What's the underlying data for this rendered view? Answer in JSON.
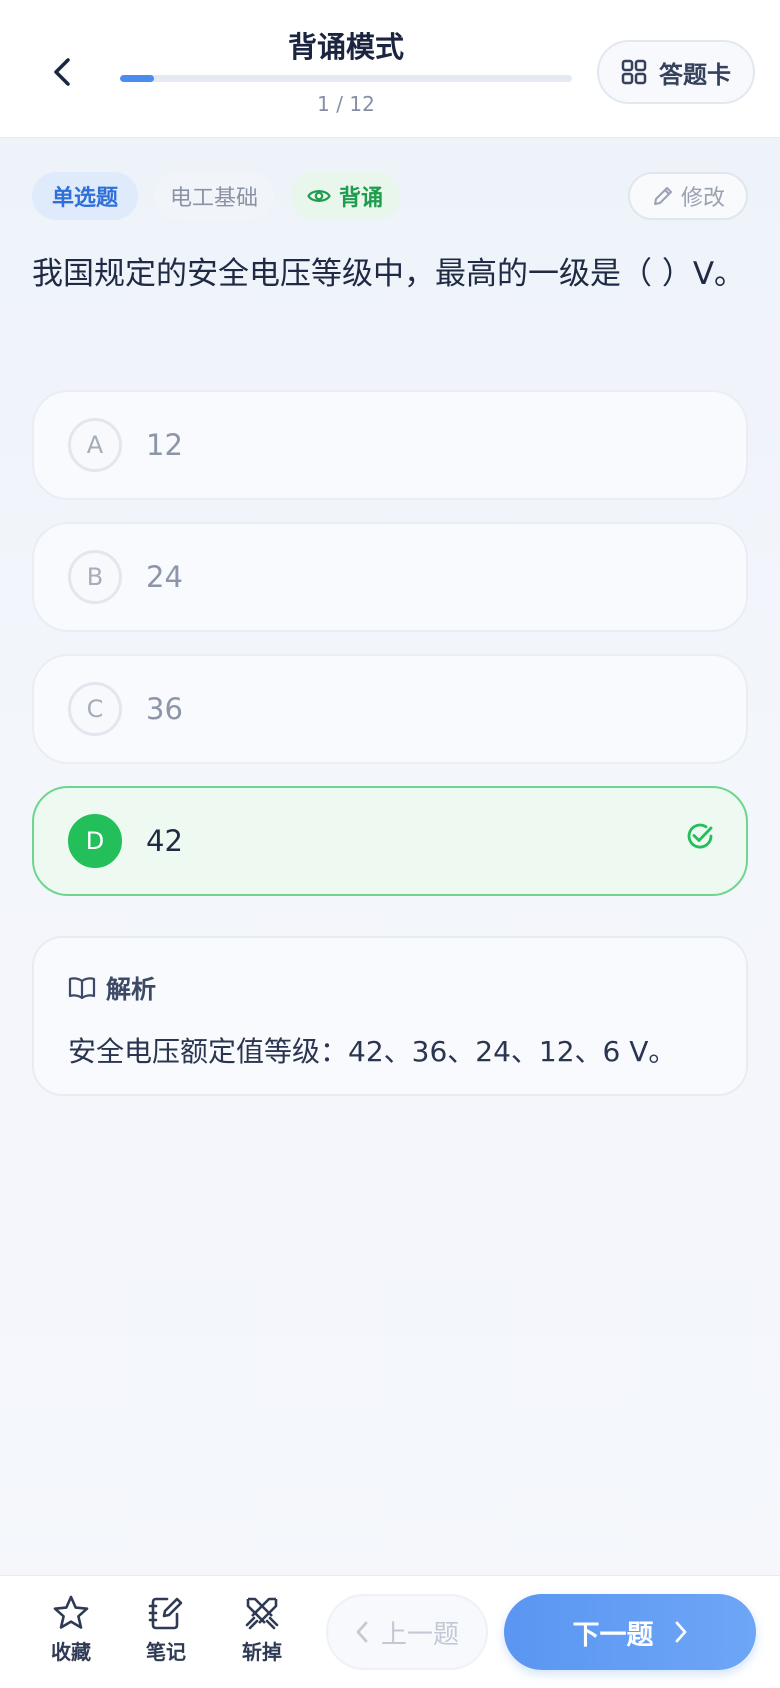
{
  "header": {
    "title": "背诵模式",
    "progress_text": "1 / 12",
    "progress_fraction": 0.075,
    "answer_card_label": "答题卡",
    "accent_color": "#4a8cf0"
  },
  "tags": {
    "type": "单选题",
    "category": "电工基础",
    "mode": "背诵",
    "edit_label": "修改"
  },
  "question": {
    "text": "我国规定的安全电压等级中，最高的一级是（ ）V。"
  },
  "options": [
    {
      "letter": "A",
      "text": "12",
      "correct": false
    },
    {
      "letter": "B",
      "text": "24",
      "correct": false
    },
    {
      "letter": "C",
      "text": "36",
      "correct": false
    },
    {
      "letter": "D",
      "text": "42",
      "correct": true
    }
  ],
  "analysis": {
    "heading": "解析",
    "body": "安全电压额定值等级：42、36、24、12、6 V。"
  },
  "bottom_bar": {
    "favorite_label": "收藏",
    "note_label": "笔记",
    "remove_label": "斩掉",
    "prev_label": "上一题",
    "next_label": "下一题",
    "correct_color": "#22bf5a"
  }
}
